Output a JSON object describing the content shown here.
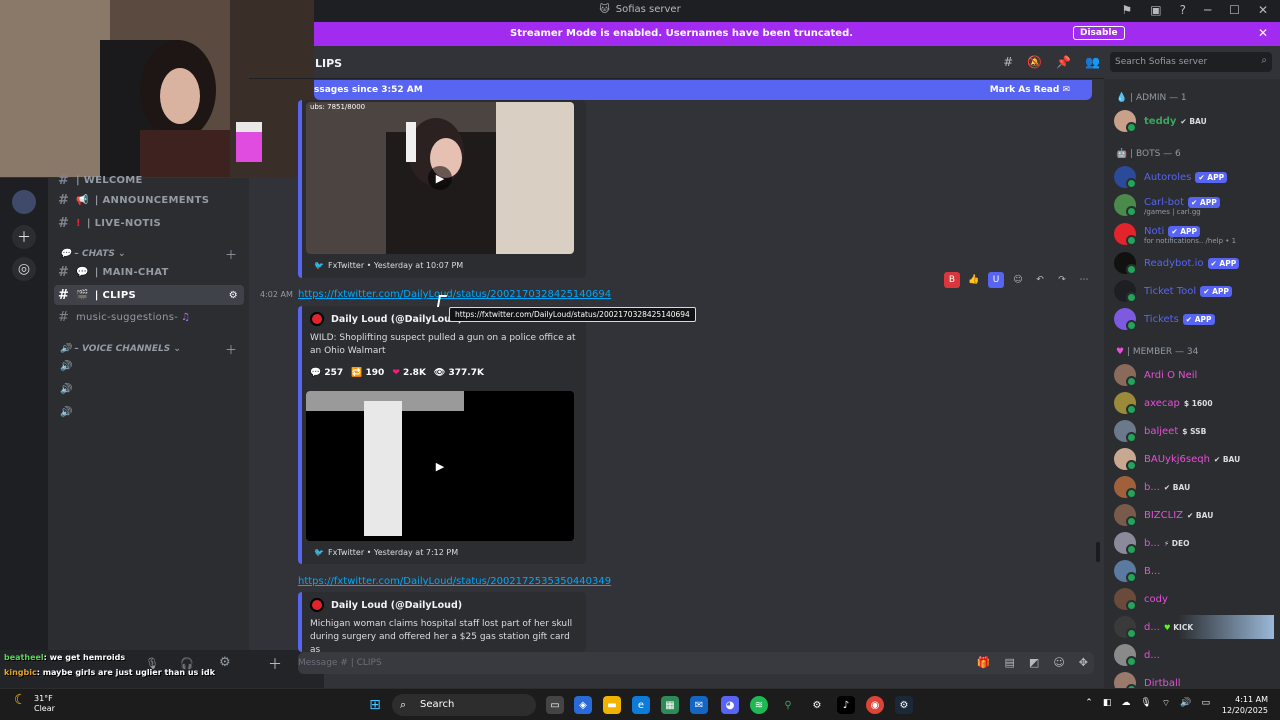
{
  "window": {
    "title": "Sofias server"
  },
  "banner": {
    "text": "Streamer Mode is enabled. Usernames have been truncated.",
    "button": "Disable"
  },
  "channel": {
    "title": "LIPS",
    "search_placeholder": "Search Sofias server"
  },
  "new_messages": {
    "text": "ssages since 3:52 AM",
    "mark": "Mark As Read"
  },
  "channels": [
    {
      "label": "| WELCOME"
    },
    {
      "label": "| ANNOUNCEMENTS"
    },
    {
      "label": "| LIVE-NOTIS"
    },
    {
      "label": "| MAIN-CHAT"
    },
    {
      "label": "| CLIPS"
    },
    {
      "label": "music-suggestions-"
    }
  ],
  "categories": {
    "chats": "CHATS",
    "voice": "VOICE CHANNELS"
  },
  "messages": {
    "m1": {
      "viewers": "ubs: 7851/8000",
      "footer": "FxTwitter • Yesterday at 10:07 PM"
    },
    "m2": {
      "time": "4:02 AM",
      "link": "https://fxtwitter.com/DailyLoud/status/2002170328425140694",
      "author": "Daily Loud (@DailyLoud)",
      "text": "WILD: Shoplifting suspect pulled a gun on a police office at an Ohio Walmart",
      "replies": "257",
      "retweets": "190",
      "likes": "2.8K",
      "views": "377.7K",
      "footer": "FxTwitter • Yesterday at 7:12 PM"
    },
    "m3": {
      "link": "https://fxtwitter.com/DailyLoud/status/2002172535350440349",
      "author": "Daily Loud (@DailyLoud)",
      "text": "Michigan woman claims hospital staff lost part of her skull during surgery and offered her a $25 gas station gift card as"
    }
  },
  "tooltip": "https://fxtwitter.com/DailyLoud/status/2002170328425140694",
  "composer": {
    "placeholder": "Message # | CLIPS"
  },
  "stream_chat": [
    {
      "user": "beatheel",
      "text": ": we get hemroids"
    },
    {
      "user": "kingbic",
      "text": ": maybe girls are just uglier than us idk"
    }
  ],
  "members": {
    "admin_header": "| ADMIN — 1",
    "bots_header": "| BOTS — 6",
    "member_header": "| MEMBER — 34",
    "admin": [
      {
        "name": "teddy",
        "tag": "BAU"
      }
    ],
    "bots": [
      {
        "name": "Autoroles",
        "tag": "APP"
      },
      {
        "name": "Carl-bot",
        "tag": "APP",
        "sub": "/games | carl.gg"
      },
      {
        "name": "Noti",
        "tag": "APP",
        "sub": "for notifications.. /help • 1"
      },
      {
        "name": "Readybot.io",
        "tag": "APP"
      },
      {
        "name": "Ticket Tool",
        "tag": "APP"
      },
      {
        "name": "Tickets",
        "tag": "APP"
      }
    ],
    "users": [
      {
        "name": "Ardi O Neil",
        "tag": ""
      },
      {
        "name": "axecap",
        "tag": "1600"
      },
      {
        "name": "baljeet",
        "tag": "SSB"
      },
      {
        "name": "BAUykj6seqh",
        "tag": "BAU"
      },
      {
        "name": "b...",
        "tag": "BAU"
      },
      {
        "name": "BIZCLIZ",
        "tag": "BAU"
      },
      {
        "name": "b...",
        "tag": "DEO"
      },
      {
        "name": "B...",
        "tag": ""
      },
      {
        "name": "cody",
        "tag": ""
      },
      {
        "name": "d...",
        "tag": "KICK"
      },
      {
        "name": "d...",
        "tag": ""
      },
      {
        "name": "Dirtball",
        "tag": ""
      }
    ]
  },
  "taskbar": {
    "temp": "31°F",
    "cond": "Clear",
    "search": "Search",
    "time": "4:11 AM",
    "date": "12/20/2025"
  },
  "colors": {
    "accent": "#5865f2",
    "banner": "#a12cf0",
    "link": "#00a8fc",
    "member_name": "#e84fd8",
    "bot_name": "#5865f2"
  }
}
